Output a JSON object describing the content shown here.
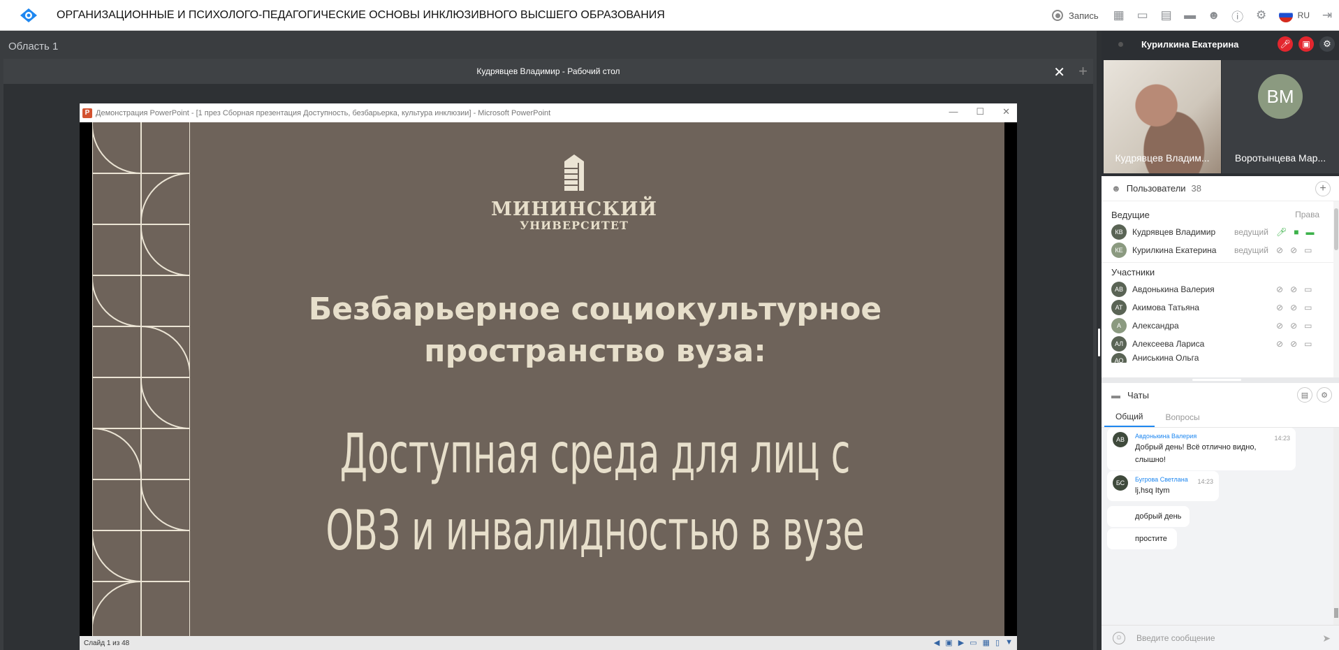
{
  "topbar": {
    "title": "ОРГАНИЗАЦИОННЫЕ И ПСИХОЛОГО-ПЕДАГОГИЧЕСКИЕ ОСНОВЫ ИНКЛЮЗИВНОГО ВЫСШЕГО ОБРАЗОВАНИЯ",
    "record_label": "Запись",
    "lang": "RU",
    "icons": [
      "apps-icon",
      "screen-icon",
      "presentation-icon",
      "folder-icon",
      "users-icon",
      "info-icon",
      "gear-icon",
      "flag-ru-icon",
      "exit-icon"
    ]
  },
  "workspace": {
    "area_label": "Область 1",
    "share_title": "Кудрявцев Владимир - Рабочий стол",
    "ppt_window_title": "Демонстрация PowerPoint - [1 през Сборная презентация Доступность, безбарьерка, культура инклюзии] - Microsoft PowerPoint",
    "slide": {
      "logo_line1": "МИНИНСКИЙ",
      "logo_line2": "УНИВЕРСИТЕТ",
      "heading": "Безбарьерное социокультурное пространство вуза:",
      "subheading": "Доступная среда для лиц с ОВЗ и инвалидностью в вузе"
    },
    "status": "Слайд 1 из 48"
  },
  "video": {
    "self_name": "Курилкина Екатерина",
    "tiles": [
      {
        "name": "Кудрявцев Владим..."
      },
      {
        "name": "Воротынцева Мар...",
        "initials": "ВМ"
      }
    ]
  },
  "users": {
    "title": "Пользователи",
    "count": "38",
    "hosts_label": "Ведущие",
    "rights_label": "Права",
    "hosts": [
      {
        "initials": "КВ",
        "name": "Кудрявцев Владимир",
        "role": "ведущий"
      },
      {
        "initials": "КЕ",
        "name": "Курилкина Екатерина",
        "role": "ведущий"
      }
    ],
    "participants_label": "Участники",
    "participants": [
      {
        "initials": "АВ",
        "name": "Авдонькина Валерия"
      },
      {
        "initials": "АТ",
        "name": "Акимова Татьяна"
      },
      {
        "initials": "А",
        "name": "Александра"
      },
      {
        "initials": "АЛ",
        "name": "Алексеева Лариса"
      },
      {
        "initials": "АО",
        "name": "Аниськина Ольга"
      }
    ]
  },
  "chat": {
    "title": "Чаты",
    "tabs": [
      "Общий",
      "Вопросы"
    ],
    "messages": [
      {
        "initials": "АВ",
        "author": "Авдонькина Валерия",
        "time": "14:23",
        "text": "Добрый день! Всё отлично видно, слышно!"
      },
      {
        "initials": "БС",
        "author": "Бугрова Светлана",
        "time": "14:23",
        "text": "lj,hsq Itym"
      },
      {
        "text": "добрый день"
      },
      {
        "text": "простите"
      }
    ],
    "input_placeholder": "Введите сообщение"
  },
  "colors": {
    "slide_bg": "#6e635a",
    "slide_text": "#e7dfcb",
    "accent": "#1e87f0",
    "mute_red": "#e3262e",
    "on_green": "#3cb24a"
  }
}
